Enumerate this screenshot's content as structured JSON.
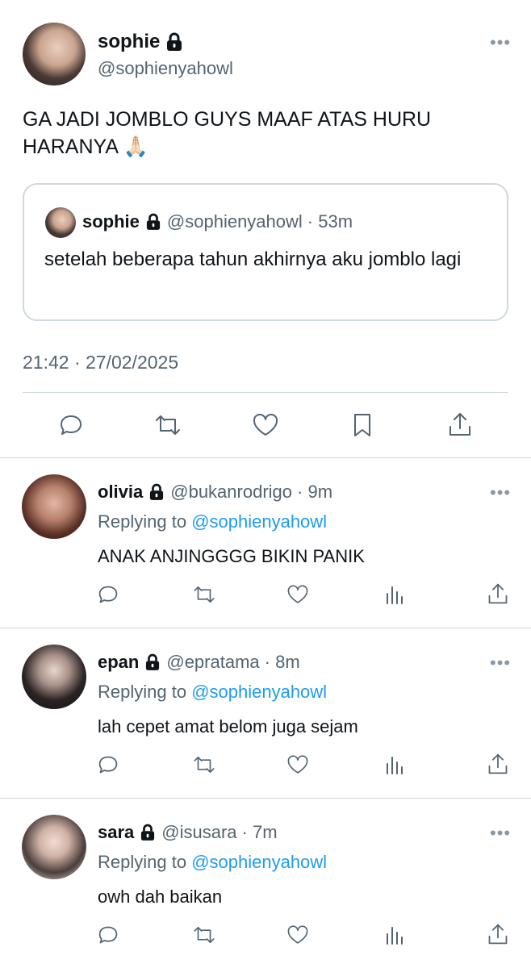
{
  "main_tweet": {
    "name": "sophie",
    "handle": "@sophienyahowl",
    "text": "GA JADI JOMBLO GUYS MAAF ATAS HURU HARANYA 🙏🏻",
    "more": "•••",
    "timestamp": "21:42 · 27/02/2025"
  },
  "quoted_tweet": {
    "name": "sophie",
    "handle": "@sophienyahowl",
    "time": "· 53m",
    "text": "setelah beberapa tahun akhirnya aku jomblo lagi"
  },
  "main_actions": [
    "reply-icon",
    "retweet-icon",
    "like-icon",
    "bookmark-icon",
    "share-icon"
  ],
  "replies": [
    {
      "name": "olivia",
      "handle": "@bukanrodrigo",
      "time": "· 9m",
      "replying_prefix": "Replying to ",
      "replying_to": "@sophienyahowl",
      "text": "ANAK ANJINGGGG BIKIN PANIK",
      "more": "•••"
    },
    {
      "name": "epan",
      "handle": "@epratama",
      "time": "· 8m",
      "replying_prefix": "Replying to ",
      "replying_to": "@sophienyahowl",
      "text": "lah cepet amat belom juga sejam",
      "more": "•••"
    },
    {
      "name": "sara",
      "handle": "@isusara",
      "time": "· 7m",
      "replying_prefix": "Replying to ",
      "replying_to": "@sophienyahowl",
      "text": "owh dah baikan",
      "more": "•••"
    }
  ],
  "reply_actions": [
    "reply-icon",
    "retweet-icon",
    "like-icon",
    "views-icon",
    "share-icon"
  ],
  "colors": {
    "link": "#1d9bf0",
    "secondary_text": "#536471",
    "border": "#cfd9de"
  }
}
